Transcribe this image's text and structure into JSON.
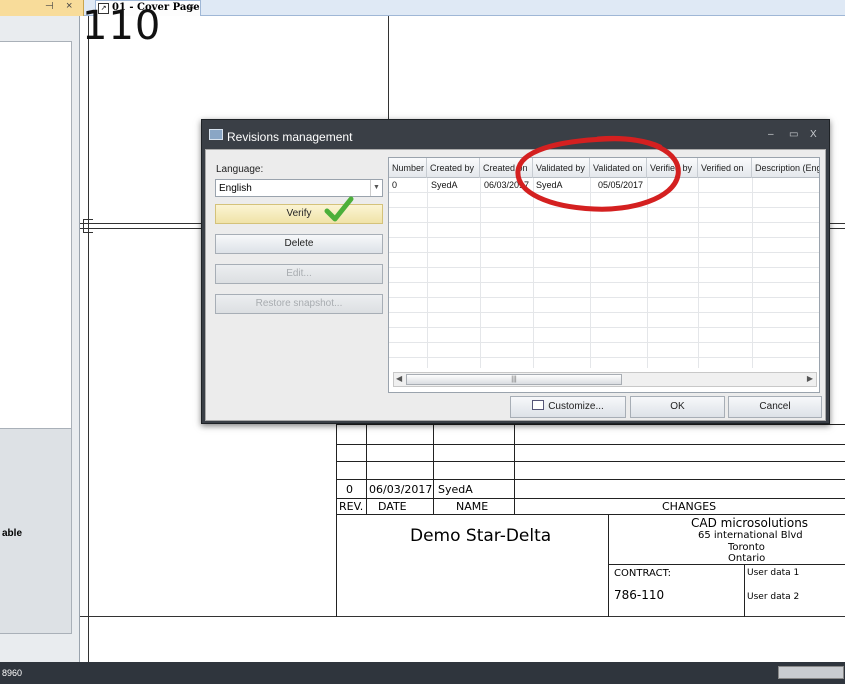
{
  "tabs": {
    "left_pin": " &#x1F4CC;",
    "left_close": "×",
    "doc_tab_label": "01 - Cover Page",
    "doc_tab_close": "×"
  },
  "left_panel": {
    "lower_label": "able"
  },
  "drawing": {
    "big_number": "110"
  },
  "title_block": {
    "rev_number": "0",
    "rev_date": "06/03/2017",
    "rev_name": "SyedA",
    "header_rev": "REV.",
    "header_date": "DATE",
    "header_name": "NAME",
    "header_changes": "CHANGES",
    "project_name": "Demo Star-Delta",
    "company": "CAD microsolutions",
    "address_1": "65 international Blvd",
    "address_2": "Toronto",
    "address_3": "Ontario",
    "contract_label": "CONTRACT:",
    "contract_value": "786-110",
    "user_data_1": "User data 1",
    "user_data_2": "User data 2"
  },
  "status_bar": {
    "coord": "8960"
  },
  "dialog": {
    "title": "Revisions management",
    "win_min": "–",
    "win_max": "▭",
    "win_close": "X",
    "language_label": "Language:",
    "language_value": "English",
    "buttons": {
      "verify": "Verify",
      "delete": "Delete",
      "edit": "Edit...",
      "restore": "Restore snapshot..."
    },
    "grid": {
      "columns": [
        "Number",
        "Created by",
        "Created on",
        "Validated by",
        "Validated on",
        "Verified by",
        "Verified on",
        "Description (Engli"
      ],
      "row": {
        "number": "0",
        "created_by": "SyedA",
        "created_on": "06/03/2017",
        "validated_by": "SyedA",
        "validated_on": "05/05/2017"
      },
      "scroll_thumb": "|||"
    },
    "footer": {
      "customize": "Customize...",
      "ok": "OK",
      "cancel": "Cancel"
    }
  },
  "colors": {
    "accent_red": "#d42020",
    "check_green": "#4caf3a",
    "dialog_frame": "#3a3f46",
    "status_bar": "#2f353d"
  }
}
